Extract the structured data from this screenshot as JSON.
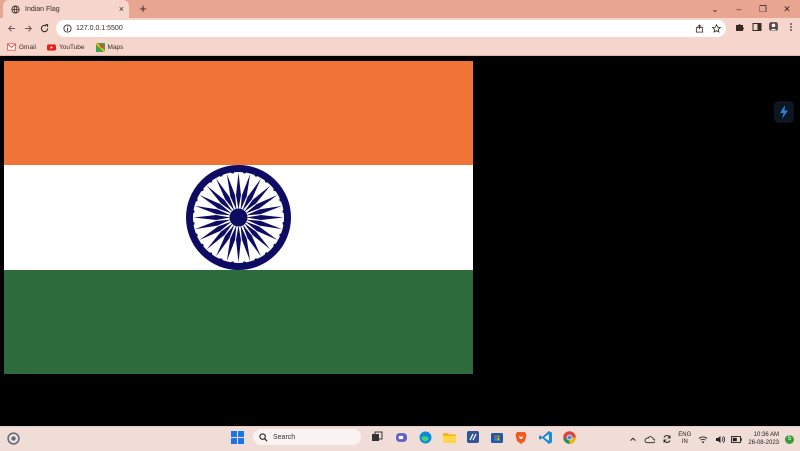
{
  "browser": {
    "tab": {
      "title": "Indian Flag",
      "close": "×"
    },
    "new_tab": "+",
    "window_controls": {
      "dropdown": "⌄",
      "minimize": "–",
      "maximize": "❐",
      "close": "✕"
    },
    "address": {
      "url": "127.0.0.1:5500"
    },
    "bookmarks": [
      {
        "label": "Gmail",
        "icon": "gmail-icon"
      },
      {
        "label": "YouTube",
        "icon": "youtube-icon"
      },
      {
        "label": "Maps",
        "icon": "maps-icon"
      }
    ]
  },
  "page": {
    "flag": {
      "colors": {
        "saffron": "#f07338",
        "white": "#ffffff",
        "green": "#2d6a3c",
        "chakra": "#0e0b62"
      },
      "chakra_spokes": 24
    }
  },
  "taskbar": {
    "search_label": "Search",
    "language": {
      "line1": "ENG",
      "line2": "IN"
    },
    "clock": {
      "time": "10:36 AM",
      "date": "26-08-2023"
    },
    "notification_count": "5"
  }
}
